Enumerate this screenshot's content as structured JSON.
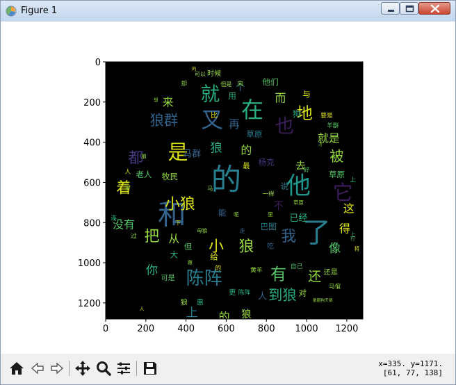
{
  "window": {
    "title": "Figure 1"
  },
  "figure": {
    "image_colormap_note": "",
    "x_ticks": [
      "0",
      "200",
      "400",
      "600",
      "800",
      "1000",
      "1200"
    ],
    "y_ticks": [
      "0",
      "200",
      "400",
      "600",
      "800",
      "1000",
      "1200"
    ],
    "x_range": [
      0,
      1280
    ],
    "y_range": [
      0,
      1280
    ],
    "background_color": "#000000",
    "palette": [
      "#3b1c5a",
      "#453781",
      "#33638d",
      "#287d8e",
      "#1f968b",
      "#29af7f",
      "#55c667",
      "#95d840",
      "#dce319"
    ],
    "words": [
      {
        "text": "的",
        "x": 600,
        "y": 590,
        "size": 150,
        "color": "#287d8e"
      },
      {
        "text": "和",
        "x": 330,
        "y": 760,
        "size": 140,
        "color": "#33638d"
      },
      {
        "text": "了",
        "x": 1050,
        "y": 850,
        "size": 140,
        "color": "#287d8e"
      },
      {
        "text": "他",
        "x": 960,
        "y": 620,
        "size": 120,
        "color": "#1f968b"
      },
      {
        "text": "在",
        "x": 730,
        "y": 240,
        "size": 110,
        "color": "#29af7f"
      },
      {
        "text": "又",
        "x": 530,
        "y": 290,
        "size": 110,
        "color": "#33638d"
      },
      {
        "text": "就",
        "x": 520,
        "y": 160,
        "size": 95,
        "color": "#29af7f"
      },
      {
        "text": "也",
        "x": 890,
        "y": 320,
        "size": 95,
        "color": "#3b1c5a"
      },
      {
        "text": "是",
        "x": 360,
        "y": 450,
        "size": 100,
        "color": "#dce319"
      },
      {
        "text": "它",
        "x": 1180,
        "y": 650,
        "size": 100,
        "color": "#3b1c5a"
      },
      {
        "text": "陈阵",
        "x": 490,
        "y": 1080,
        "size": 90,
        "color": "#287d8e"
      },
      {
        "text": "地",
        "x": 990,
        "y": 260,
        "size": 80,
        "color": "#dce319"
      },
      {
        "text": "狼群",
        "x": 290,
        "y": 290,
        "size": 70,
        "color": "#33638d"
      },
      {
        "text": "小狼",
        "x": 370,
        "y": 710,
        "size": 75,
        "color": "#dce319"
      },
      {
        "text": "小",
        "x": 550,
        "y": 920,
        "size": 75,
        "color": "#dce319"
      },
      {
        "text": "狼",
        "x": 700,
        "y": 920,
        "size": 75,
        "color": "#95d840"
      },
      {
        "text": "有",
        "x": 860,
        "y": 1060,
        "size": 80,
        "color": "#55c667"
      },
      {
        "text": "我",
        "x": 910,
        "y": 870,
        "size": 75,
        "color": "#33638d"
      },
      {
        "text": "到狼",
        "x": 880,
        "y": 1160,
        "size": 70,
        "color": "#29af7f"
      },
      {
        "text": "把",
        "x": 230,
        "y": 870,
        "size": 75,
        "color": "#95d840"
      },
      {
        "text": "着",
        "x": 90,
        "y": 630,
        "size": 75,
        "color": "#dce319"
      },
      {
        "text": "都",
        "x": 150,
        "y": 480,
        "size": 75,
        "color": "#453781"
      },
      {
        "text": "被",
        "x": 1150,
        "y": 470,
        "size": 70,
        "color": "#95d840"
      },
      {
        "text": "就是",
        "x": 1110,
        "y": 380,
        "size": 55,
        "color": "#95d840"
      },
      {
        "text": "像",
        "x": 1140,
        "y": 930,
        "size": 60,
        "color": "#55c667"
      },
      {
        "text": "还",
        "x": 1040,
        "y": 1070,
        "size": 65,
        "color": "#95d840"
      },
      {
        "text": "你",
        "x": 230,
        "y": 1040,
        "size": 60,
        "color": "#29af7f"
      },
      {
        "text": "上",
        "x": 430,
        "y": 1250,
        "size": 60,
        "color": "#287d8e"
      },
      {
        "text": "的",
        "x": 590,
        "y": 1270,
        "size": 55,
        "color": "#95d840"
      },
      {
        "text": "狼",
        "x": 700,
        "y": 1260,
        "size": 50,
        "color": "#95d840"
      },
      {
        "text": "得",
        "x": 1190,
        "y": 830,
        "size": 55,
        "color": "#dce319"
      },
      {
        "text": "这",
        "x": 1210,
        "y": 730,
        "size": 55,
        "color": "#dce319"
      },
      {
        "text": "从",
        "x": 340,
        "y": 880,
        "size": 55,
        "color": "#95d840"
      },
      {
        "text": "再",
        "x": 640,
        "y": 310,
        "size": 55,
        "color": "#33638d"
      },
      {
        "text": "而",
        "x": 870,
        "y": 180,
        "size": 55,
        "color": "#95d840"
      },
      {
        "text": "狼",
        "x": 550,
        "y": 430,
        "size": 60,
        "color": "#29af7f"
      },
      {
        "text": "的",
        "x": 700,
        "y": 440,
        "size": 55,
        "color": "#95d840"
      },
      {
        "text": "来",
        "x": 310,
        "y": 200,
        "size": 55,
        "color": "#95d840"
      },
      {
        "text": "没有",
        "x": 90,
        "y": 810,
        "size": 55,
        "color": "#55c667"
      },
      {
        "text": "去",
        "x": 970,
        "y": 520,
        "size": 50,
        "color": "#95d840"
      },
      {
        "text": "不",
        "x": 860,
        "y": 720,
        "size": 50,
        "color": "#3b1c5a"
      },
      {
        "text": "已经",
        "x": 960,
        "y": 780,
        "size": 45,
        "color": "#29af7f"
      },
      {
        "text": "个",
        "x": 670,
        "y": 130,
        "size": 45,
        "color": "#287d8e"
      },
      {
        "text": "人",
        "x": 780,
        "y": 1170,
        "size": 45,
        "color": "#33638d"
      },
      {
        "text": "给",
        "x": 540,
        "y": 970,
        "size": 40,
        "color": "#dce319"
      },
      {
        "text": "马群",
        "x": 430,
        "y": 460,
        "size": 45,
        "color": "#33638d"
      },
      {
        "text": "他们",
        "x": 820,
        "y": 100,
        "size": 40,
        "color": "#55c667"
      },
      {
        "text": "与",
        "x": 1000,
        "y": 160,
        "size": 40,
        "color": "#dce319"
      },
      {
        "text": "用",
        "x": 630,
        "y": 170,
        "size": 40,
        "color": "#29af7f"
      },
      {
        "text": "狗",
        "x": 950,
        "y": 260,
        "size": 40,
        "color": "#29af7f"
      },
      {
        "text": "草原",
        "x": 740,
        "y": 360,
        "size": 40,
        "color": "#287d8e"
      },
      {
        "text": "杨克",
        "x": 800,
        "y": 500,
        "size": 40,
        "color": "#453781"
      },
      {
        "text": "说",
        "x": 890,
        "y": 620,
        "size": 40,
        "color": "#287d8e"
      },
      {
        "text": "巴图",
        "x": 810,
        "y": 820,
        "size": 40,
        "color": "#287d8e"
      },
      {
        "text": "能",
        "x": 580,
        "y": 750,
        "size": 40,
        "color": "#33638d"
      },
      {
        "text": "大",
        "x": 340,
        "y": 960,
        "size": 40,
        "color": "#29af7f"
      },
      {
        "text": "对",
        "x": 980,
        "y": 1150,
        "size": 40,
        "color": "#95d840"
      },
      {
        "text": "但",
        "x": 410,
        "y": 920,
        "size": 40,
        "color": "#55c667"
      },
      {
        "text": "草原",
        "x": 1150,
        "y": 560,
        "size": 40,
        "color": "#55c667"
      },
      {
        "text": "老人",
        "x": 190,
        "y": 560,
        "size": 40,
        "color": "#55c667"
      },
      {
        "text": "牧民",
        "x": 320,
        "y": 570,
        "size": 40,
        "color": "#95d840"
      },
      {
        "text": "吃",
        "x": 820,
        "y": 920,
        "size": 35,
        "color": "#33638d"
      },
      {
        "text": "还是",
        "x": 1120,
        "y": 1050,
        "size": 35,
        "color": "#95d840"
      },
      {
        "text": "时候",
        "x": 540,
        "y": 60,
        "size": 35,
        "color": "#95d840"
      },
      {
        "text": "比",
        "x": 540,
        "y": 270,
        "size": 35,
        "color": "#dce319"
      },
      {
        "text": "最",
        "x": 700,
        "y": 520,
        "size": 35,
        "color": "#dce319"
      },
      {
        "text": "可是",
        "x": 310,
        "y": 1080,
        "size": 35,
        "color": "#55c667"
      },
      {
        "text": "一样",
        "x": 810,
        "y": 660,
        "size": 30,
        "color": "#95d840"
      },
      {
        "text": "黄羊",
        "x": 750,
        "y": 1040,
        "size": 30,
        "color": "#95d840"
      },
      {
        "text": "更",
        "x": 630,
        "y": 1150,
        "size": 35,
        "color": "#29af7f"
      },
      {
        "text": "陈阵",
        "x": 690,
        "y": 1150,
        "size": 30,
        "color": "#29af7f"
      },
      {
        "text": "马倌",
        "x": 1140,
        "y": 1120,
        "size": 30,
        "color": "#95d840"
      },
      {
        "text": "自己",
        "x": 950,
        "y": 1020,
        "size": 30,
        "color": "#55c667"
      },
      {
        "text": "羊群",
        "x": 1130,
        "y": 320,
        "size": 30,
        "color": "#55c667"
      },
      {
        "text": "要是",
        "x": 1100,
        "y": 270,
        "size": 30,
        "color": "#dce319"
      },
      {
        "text": "好",
        "x": 1000,
        "y": 540,
        "size": 30,
        "color": "#55c667"
      },
      {
        "text": "上",
        "x": 1230,
        "y": 590,
        "size": 30,
        "color": "#29af7f"
      },
      {
        "text": "人",
        "x": 110,
        "y": 550,
        "size": 30,
        "color": "#dce319"
      },
      {
        "text": "过",
        "x": 140,
        "y": 870,
        "size": 30,
        "color": "#95d840"
      },
      {
        "text": "连",
        "x": 40,
        "y": 780,
        "size": 30,
        "color": "#29af7f"
      },
      {
        "text": "狼",
        "x": 390,
        "y": 1200,
        "size": 35,
        "color": "#95d840"
      },
      {
        "text": "惠",
        "x": 470,
        "y": 1200,
        "size": 35,
        "color": "#29af7f"
      },
      {
        "text": "的",
        "x": 560,
        "y": 1030,
        "size": 30,
        "color": "#dce319"
      },
      {
        "text": "向",
        "x": 670,
        "y": 110,
        "size": 30,
        "color": "#95d840"
      },
      {
        "text": "但是",
        "x": 600,
        "y": 110,
        "size": 28,
        "color": "#95d840"
      },
      {
        "text": "可以",
        "x": 470,
        "y": 60,
        "size": 28,
        "color": "#95d840"
      },
      {
        "text": "却",
        "x": 390,
        "y": 110,
        "size": 30,
        "color": "#95d840"
      },
      {
        "text": "母狼",
        "x": 480,
        "y": 840,
        "size": 26,
        "color": "#95d840"
      },
      {
        "text": "下",
        "x": 360,
        "y": 800,
        "size": 28,
        "color": "#dce319"
      },
      {
        "text": "马",
        "x": 520,
        "y": 630,
        "size": 28,
        "color": "#95d840"
      },
      {
        "text": "走",
        "x": 680,
        "y": 840,
        "size": 28,
        "color": "#33638d"
      },
      {
        "text": "呢",
        "x": 650,
        "y": 760,
        "size": 26,
        "color": "#95d840"
      },
      {
        "text": "草原",
        "x": 960,
        "y": 700,
        "size": 26,
        "color": "#95d840"
      },
      {
        "text": "上",
        "x": 1230,
        "y": 860,
        "size": 26,
        "color": "#29af7f"
      },
      {
        "text": "将",
        "x": 1250,
        "y": 930,
        "size": 26,
        "color": "#dce319"
      },
      {
        "text": "打",
        "x": 1230,
        "y": 880,
        "size": 22,
        "color": "#55c667"
      },
      {
        "text": "狼",
        "x": 190,
        "y": 470,
        "size": 26,
        "color": "#95d840"
      },
      {
        "text": "里",
        "x": 820,
        "y": 760,
        "size": 26,
        "color": "#95d840"
      },
      {
        "text": "想",
        "x": 250,
        "y": 190,
        "size": 22,
        "color": "#95d840"
      },
      {
        "text": "才",
        "x": 1070,
        "y": 410,
        "size": 22,
        "color": "#95d840"
      },
      {
        "text": "人",
        "x": 180,
        "y": 1230,
        "size": 22,
        "color": "#dce319"
      },
      {
        "text": "的",
        "x": 440,
        "y": 35,
        "size": 22,
        "color": "#dce319"
      },
      {
        "text": "狼圈狗",
        "x": 1060,
        "y": 1190,
        "size": 20,
        "color": "#95d840"
      },
      {
        "text": "天狼",
        "x": 1110,
        "y": 1190,
        "size": 20,
        "color": "#95d840"
      },
      {
        "text": "狼",
        "x": 110,
        "y": 630,
        "size": 24,
        "color": "#95d840"
      },
      {
        "text": "跟",
        "x": 420,
        "y": 1000,
        "size": 24,
        "color": "#95d840"
      }
    ]
  },
  "toolbar": {
    "coords_line1": "x=335. y=1171.",
    "coords_line2": "[61, 77, 138]"
  }
}
